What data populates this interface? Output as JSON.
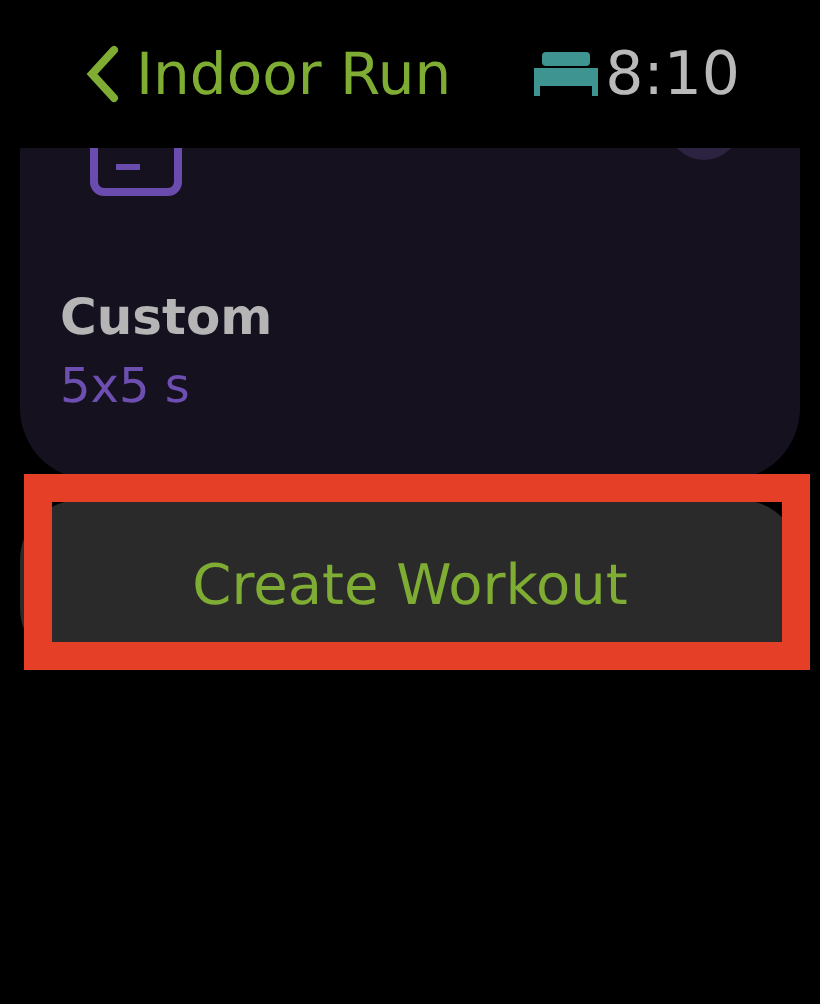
{
  "header": {
    "back_label": "Indoor Run",
    "time": "8:10"
  },
  "card": {
    "title": "Custom",
    "subtitle": "5x5 s"
  },
  "button": {
    "label": "Create Workout",
    "highlighted": true
  }
}
